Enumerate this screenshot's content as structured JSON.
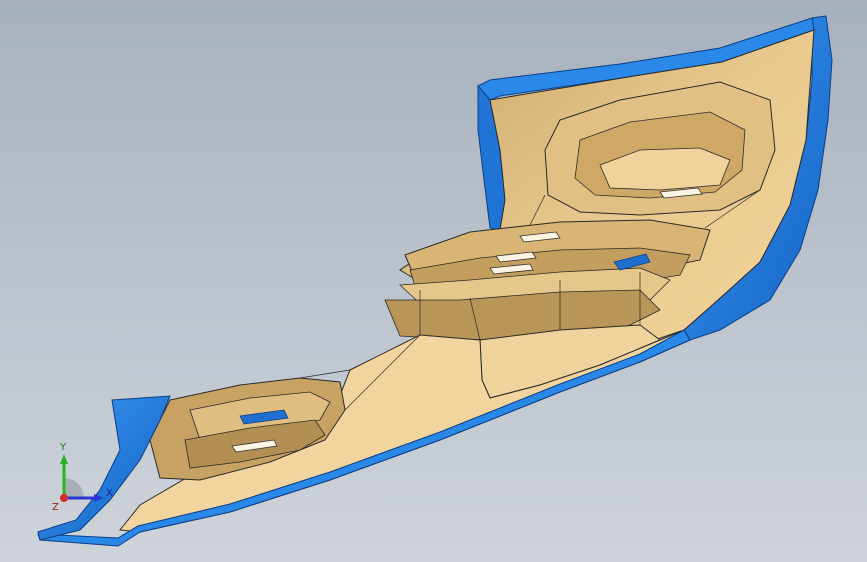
{
  "viewport": {
    "background_top": "#a7b1bd",
    "background_bottom": "#cfd4da"
  },
  "model": {
    "surface_color": "#efcf93",
    "shadow_color": "#b8975f",
    "flange_color": "#1f7be0",
    "edge_color": "#2a2a2a"
  },
  "triad": {
    "y_label": "Y",
    "x_label": "X",
    "z_label": "Z",
    "x_color": "#2a36d6",
    "y_color": "#26b526",
    "z_color": "#d42a2a"
  }
}
